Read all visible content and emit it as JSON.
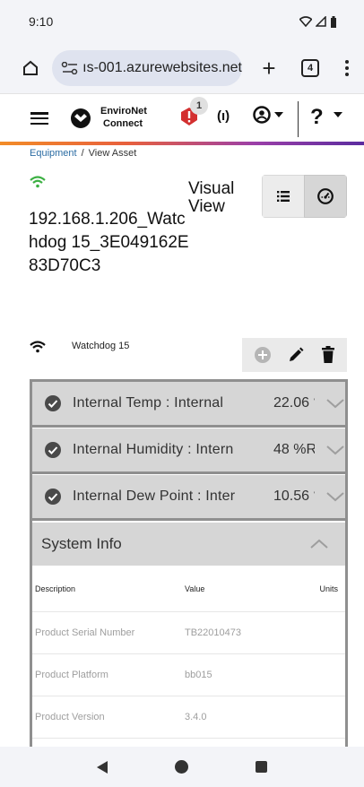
{
  "status_bar": {
    "time": "9:10"
  },
  "browser": {
    "url": "ıs-001.azurewebsites.net",
    "tab_count": "4"
  },
  "app_header": {
    "brand_line1": "EnviroNet",
    "brand_line2": "Connect",
    "alert_count": "1",
    "help_label": "?"
  },
  "breadcrumb": {
    "parent": "Equipment",
    "separator": "/",
    "current": "View Asset"
  },
  "asset": {
    "title": "192.168.1.206_Watchdog 15_3E049162E83D70C3",
    "view_label": "Visual View",
    "device_name": "Watchdog 15"
  },
  "sensors": [
    {
      "name": "Internal Temp : Internal",
      "value": "22.06 °"
    },
    {
      "name": "Internal Humidity : Intern",
      "value": "48 %R"
    },
    {
      "name": "Internal Dew Point : Inter",
      "value": "10.56 °"
    }
  ],
  "system_info": {
    "title": "System Info",
    "columns": [
      "Description",
      "Value",
      "Units"
    ],
    "rows": [
      {
        "description": "Product Serial Number",
        "value": "TB22010473",
        "units": ""
      },
      {
        "description": "Product Platform",
        "value": "bb015",
        "units": ""
      },
      {
        "description": "Product Version",
        "value": "3.4.0",
        "units": ""
      }
    ]
  },
  "colors": {
    "link": "#2b6ca3",
    "wifi_online": "#3cb043",
    "alert": "#d32f2f",
    "accent_start": "#f28c28",
    "accent_end": "#5b2c9f"
  },
  "icons": [
    "wifi-icon",
    "signal-icon",
    "battery-icon",
    "home-icon",
    "tune-icon",
    "plus-icon",
    "tabs-icon",
    "more-icon",
    "hamburger-icon",
    "logo-icon",
    "alert-icon",
    "broadcast-icon",
    "user-icon",
    "help-icon",
    "list-icon",
    "gauge-icon",
    "add-icon",
    "edit-icon",
    "trash-icon",
    "check-circle-icon",
    "chevron-down-icon",
    "chevron-up-icon"
  ]
}
